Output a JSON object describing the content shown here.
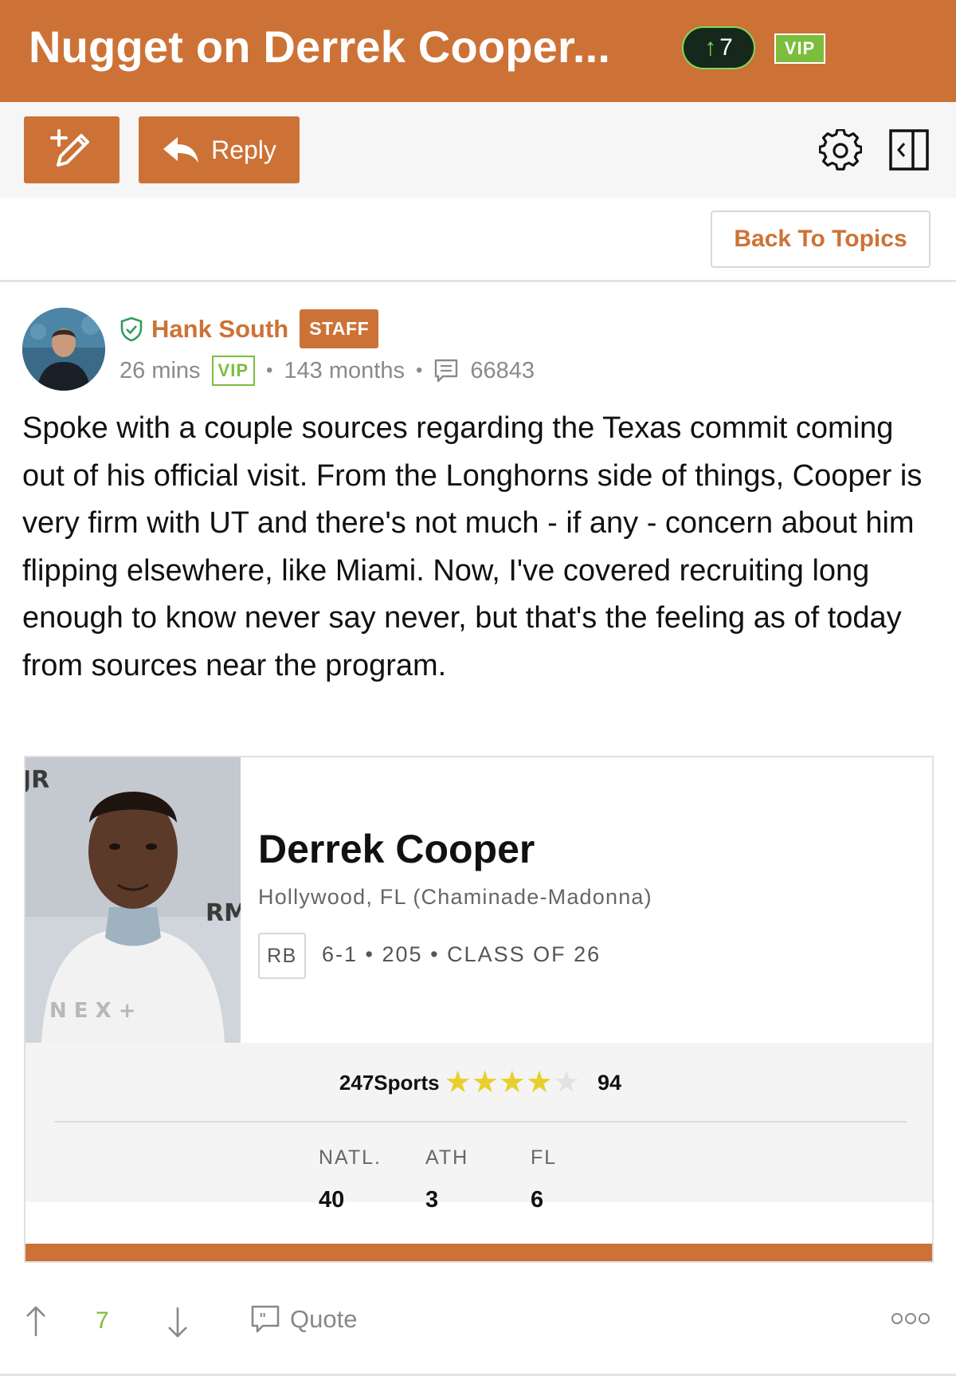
{
  "header": {
    "title": "Nugget on Derrek Cooper...",
    "vote_count": "7",
    "vip_badge": "VIP"
  },
  "toolbar": {
    "reply_label": "Reply",
    "new_post_icon": "compose-icon",
    "settings_icon": "gear-icon",
    "panel_icon": "collapse-panel-icon"
  },
  "back_button": "Back To Topics",
  "post": {
    "author": "Hank South",
    "role_badge": "STAFF",
    "time": "26 mins",
    "vip_badge": "VIP",
    "membership": "143 months",
    "post_count": "66843",
    "body": "Spoke with a couple sources regarding the Texas commit coming out of his official visit. From the Longhorns side of things, Cooper is very firm with UT and there's not much - if any - concern about him flipping elsewhere, like Miami. Now, I've covered recruiting long enough to know never say never, but that's the feeling as of today from sources near the program."
  },
  "player_card": {
    "name": "Derrek Cooper",
    "location": "Hollywood, FL (Chaminade-Madonna)",
    "position": "RB",
    "height": "6-1",
    "weight": "205",
    "class_of": "CLASS OF 26",
    "rating_source": "247Sports",
    "stars": 4,
    "max_stars": 5,
    "rating": "94",
    "rankings": [
      {
        "label": "NATL.",
        "value": "40"
      },
      {
        "label": "ATH",
        "value": "3"
      },
      {
        "label": "FL",
        "value": "6"
      }
    ]
  },
  "footer": {
    "vote_count": "7",
    "quote_label": "Quote"
  },
  "colors": {
    "brand_orange": "#cd7236",
    "vip_green": "#7bbd3c",
    "star_gold": "#e8cf2b"
  }
}
